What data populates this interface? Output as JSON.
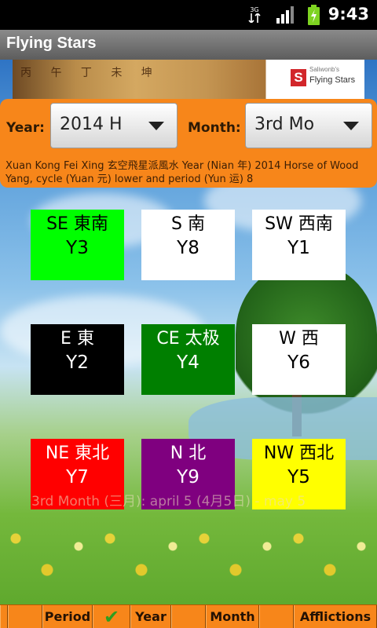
{
  "status_bar": {
    "network": "3G",
    "time": "9:43",
    "icons": [
      "network-3g-icon",
      "signal-icon",
      "battery-charging-icon"
    ]
  },
  "app": {
    "title": "Flying Stars"
  },
  "banner": {
    "compass_text": "丙 午 丁 未 坤",
    "logo_small": "Saliwonb's",
    "logo_name": "Flying Stars",
    "logo_letter": "S"
  },
  "selectors": {
    "year_label": "Year:",
    "year_value": "2014 H",
    "month_label": "Month:",
    "month_value": "3rd Mo"
  },
  "info": "Xuan Kong Fei Xing 玄空飛星派風水 Year (Nian 年) 2014 Horse of Wood Yang, cycle (Yuan 元) lower and period (Yun 运) 8",
  "grid": [
    {
      "dir": "SE 東南",
      "star": "Y3",
      "bg": "#00ff00",
      "fg": "#000000"
    },
    {
      "dir": "S 南",
      "star": "Y8",
      "bg": "#ffffff",
      "fg": "#000000"
    },
    {
      "dir": "SW 西南",
      "star": "Y1",
      "bg": "#ffffff",
      "fg": "#000000"
    },
    {
      "dir": "E 東",
      "star": "Y2",
      "bg": "#000000",
      "fg": "#ffffff"
    },
    {
      "dir": "CE 太极",
      "star": "Y4",
      "bg": "#007f00",
      "fg": "#ffffff"
    },
    {
      "dir": "W 西",
      "star": "Y6",
      "bg": "#ffffff",
      "fg": "#000000"
    },
    {
      "dir": "NE 東北",
      "star": "Y7",
      "bg": "#ff0000",
      "fg": "#ffffff"
    },
    {
      "dir": "N 北",
      "star": "Y9",
      "bg": "#7f007f",
      "fg": "#ffffff"
    },
    {
      "dir": "NW 西北",
      "star": "Y5",
      "bg": "#ffff00",
      "fg": "#000000"
    }
  ],
  "month_range": "3rd Month (三月): april 5 (4月5日) - may 5",
  "tabs": {
    "period": "Period",
    "check": "✔",
    "year": "Year",
    "month": "Month",
    "afflictions": "Afflictions"
  },
  "colors": {
    "accent": "#f7861a",
    "titlebar": "#6e6e6e",
    "status_bar": "#000000"
  }
}
